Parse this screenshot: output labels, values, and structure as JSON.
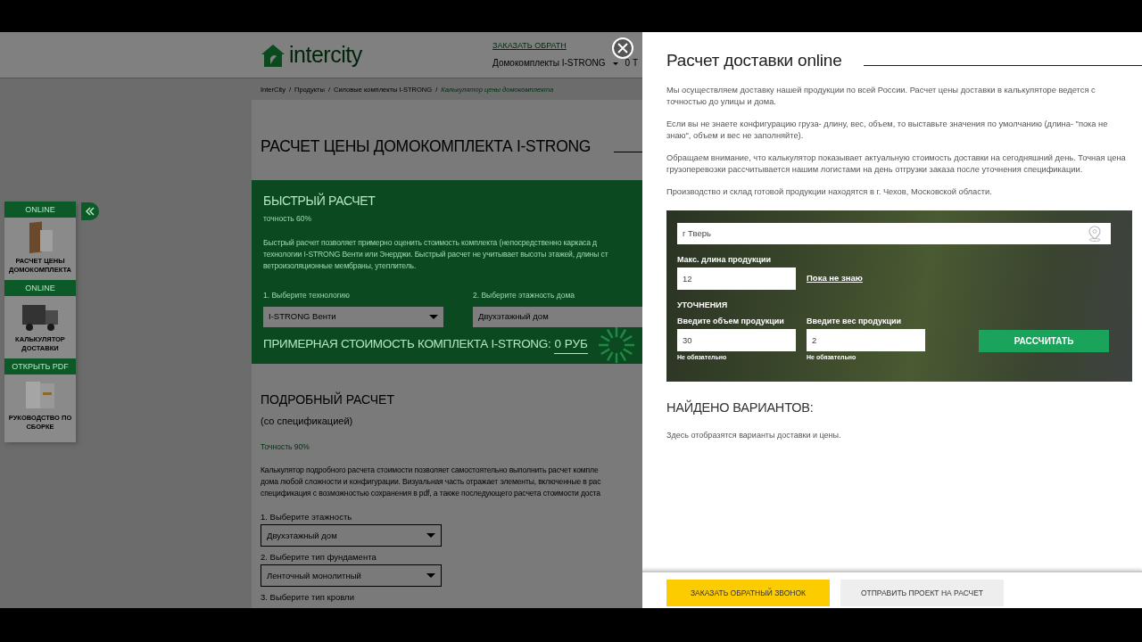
{
  "site": {
    "logo_text": "intercity",
    "callback_link": "ЗАКАЗАТЬ ОБРАТН",
    "nav": [
      {
        "label": "Домокомплекты I-STRONG",
        "kind": "dropdown"
      },
      {
        "label": "0 Т",
        "kind": "plain"
      }
    ]
  },
  "breadcrumb": [
    {
      "label": "InterCity",
      "current": false
    },
    {
      "separator": "/",
      "label": "Продукты",
      "current": false
    },
    {
      "separator": "/",
      "label": "Силовые комплекты I-STRONG",
      "current": false
    },
    {
      "separator": "/",
      "label": "Калькулятор цены домокомплекта",
      "current": true
    }
  ],
  "page_title": "РАСЧЕТ ЦЕНЫ ДОМОКОМПЛЕКТА I-STRONG",
  "side_widget": {
    "items": [
      {
        "badge": "ONLINE",
        "kind": "panel",
        "caption": "РАСЧЕТ ЦЕНЫ ДОМОКОМПЛЕКТА"
      },
      {
        "badge": "ONLINE",
        "kind": "truck",
        "caption": "КАЛЬКУЛЯТОР ДОСТАВКИ"
      },
      {
        "badge": "ОТКРЫТЬ PDF",
        "kind": "booklet",
        "caption": "РУКОВОДСТВО ПО СБОРКЕ"
      }
    ]
  },
  "quick_calc": {
    "title": "БЫСТРЫЙ РАСЧЕТ",
    "accuracy": "точность 60%",
    "description_lines": [
      "Быстрый расчет позволяет примерно оценить стоимость комплекта (непосредственно каркаса д",
      "технологии I-STRONG Венти или Энерджи. Быстрый расчет не учитывает высоты этажей, длины ст",
      "ветроизоляционные мембраны, утеплитель."
    ],
    "fields": [
      {
        "label": "1. Выберите технологию",
        "value": "I-STRONG Венти"
      },
      {
        "label": "2. Выберите этажность дома",
        "value": "Двухэтажный дом"
      }
    ],
    "price_label": "ПРИМЕРНАЯ СТОИМОСТЬ КОМПЛЕКТА I-STRONG:",
    "price_value": "0 РУБ"
  },
  "detailed_calc": {
    "title": "ПОДРОБНЫЙ РАСЧЕТ",
    "subtitle": "(со спецификацией)",
    "accuracy": "Точность 90%",
    "description_lines": [
      "Калькулятор подробного расчета стоимости позволяет самостоятельно выполнить расчет компле",
      "дома любой сложности и конфигурации. Визуальная часть отражает элементы, включенные в рас",
      "спецификация с возможностью сохранения в pdf, а также последующего расчета стоимости доста"
    ],
    "fields": [
      {
        "label": "1. Выберите этажность",
        "value": "Двухэтажный дом"
      },
      {
        "label": "2. Выберите тип фундамента",
        "value": "Ленточный монолитный"
      },
      {
        "label": "3. Выберите тип кровли"
      }
    ]
  },
  "delivery_panel": {
    "title": "Расчет доставки online",
    "paragraphs": [
      "Мы осуществляем доставку нашей продукции по всей России. Расчет цены доставки в калькуляторе ведется с точностью до улицы и дома.",
      "Если вы не знаете конфигурацию груза- длину, вес, объем, то выставьте значения по умолчанию (длина- \"пока не знаю\", объем и вес не заполняйте).",
      "Обращаем внимание, что калькулятор показывает актуальную стоимость доставки на сегодняшний день. Точная цена грузоперевозки рассчитывается нашим логистами на день отгрузки заказа после уточнения спецификации.",
      "Производство и склад готовой продукции находятся в г. Чехов, Московской области."
    ],
    "address": {
      "value": "г Тверь"
    },
    "length": {
      "label": "Макс. длина продукции",
      "value": "12",
      "link": "Пока не знаю"
    },
    "refinements_title": "УТОЧНЕНИЯ",
    "refinements": [
      {
        "label": "Введите объем продукции",
        "value": "30",
        "hint": "Не обязательно"
      },
      {
        "label": "Введите вес продукции",
        "value": "2",
        "hint": "Не обязательно"
      }
    ],
    "submit": "РАССЧИТАТЬ",
    "results_title": "НАЙДЕНО ВАРИАНТОВ:",
    "results_note": "Здесь отобразятся варианты доставки и цены.",
    "footer_buttons": [
      {
        "label": "ЗАКАЗАТЬ ОБРАТНЫЙ ЗВОНОК",
        "kind": "primary"
      },
      {
        "label": "ОТПРАВИТЬ ПРОЕКТ НА РАСЧЕТ",
        "kind": "secondary"
      }
    ]
  }
}
